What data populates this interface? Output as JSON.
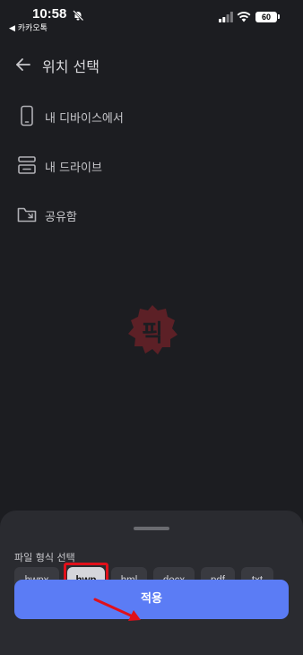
{
  "status_bar": {
    "time": "10:58",
    "back_app": "◀ 카카오톡",
    "battery": "60"
  },
  "header": {
    "title": "위치 선택"
  },
  "locations": [
    {
      "label": "내 디바이스에서",
      "icon": "phone-icon"
    },
    {
      "label": "내 드라이브",
      "icon": "drive-icon"
    },
    {
      "label": "공유함",
      "icon": "shared-folder-icon"
    }
  ],
  "watermark": {
    "text": "픽"
  },
  "sheet": {
    "title": "파일 형식 선택",
    "formats": [
      "hwpx",
      "hwp",
      "hml",
      "docx",
      "pdf",
      "txt"
    ],
    "selected_format": "hwp",
    "apply_label": "적용"
  },
  "colors": {
    "background": "#1c1d21",
    "sheet": "#2a2b30",
    "accent": "#5b7cf5",
    "annotation": "#e0101a"
  }
}
